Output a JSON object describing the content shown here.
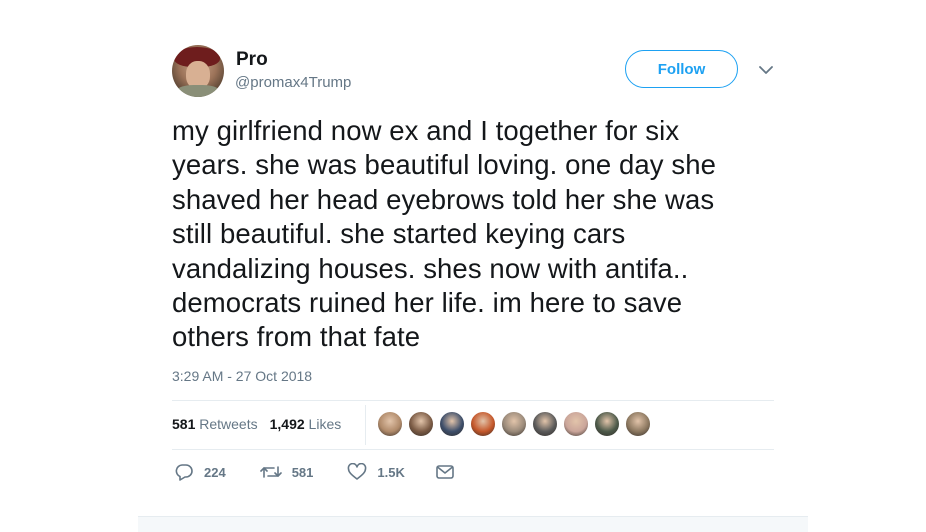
{
  "user": {
    "name": "Pro",
    "handle": "@promax4Trump"
  },
  "follow_label": "Follow",
  "tweet": {
    "text": "my girlfriend now ex and I together for six\nyears. she was beautiful loving. one day she\nshaved her head  eyebrows told her she was\nstill beautiful. she started keying cars\nvandalizing houses. shes now with antifa..\ndemocrats ruined her life. im here to save\nothers from that fate",
    "timestamp": "3:29 AM - 27 Oct 2018"
  },
  "stats": {
    "retweets_count": "581",
    "retweets_label": "Retweets",
    "likes_count": "1,492",
    "likes_label": "Likes"
  },
  "liker_avatar_colors": [
    "#b08a6a",
    "#7a5a44",
    "#3d4e6a",
    "#c4572a",
    "#9a8a7a",
    "#5a5a5a",
    "#caa59a",
    "#4d5a4a",
    "#8c7860"
  ],
  "actions": {
    "reply_count": "224",
    "retweet_count": "581",
    "like_count": "1.5K"
  },
  "icons": {
    "reply": "reply-icon",
    "retweet": "retweet-icon",
    "like": "heart-icon",
    "message": "envelope-icon",
    "caret": "chevron-down-icon"
  },
  "colors": {
    "accent": "#1da1f2",
    "muted": "#657786",
    "text": "#14171a"
  }
}
